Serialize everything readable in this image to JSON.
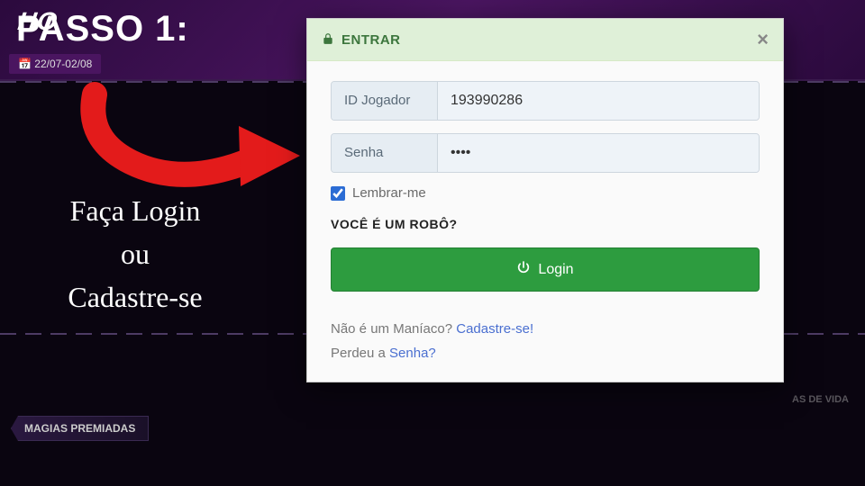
{
  "background": {
    "logo_fragment": "HO",
    "date_badge": "22/07-02/08",
    "bottom_pill": "MAGIAS PREMIADAS",
    "right_tag": "AS DE VIDA"
  },
  "tutorial": {
    "step_label": "PASSO 1:",
    "message_line1": "Faça Login",
    "message_line2": "ou",
    "message_line3": "Cadastre-se"
  },
  "modal": {
    "title": "ENTRAR",
    "player_id_label": "ID Jogador",
    "player_id_value": "193990286",
    "password_label": "Senha",
    "password_value": "••••",
    "remember_label": "Lembrar-me",
    "remember_checked": true,
    "robot_label": "VOCÊ É UM ROBÔ?",
    "login_button": "Login",
    "signup_prefix": "Não é um Maníaco? ",
    "signup_link": "Cadastre-se!",
    "forgot_prefix": "Perdeu a ",
    "forgot_link": "Senha?"
  }
}
